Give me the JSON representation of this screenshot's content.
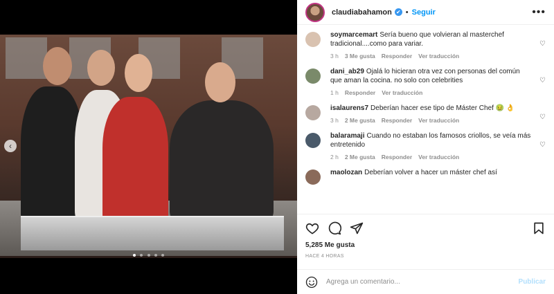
{
  "header": {
    "username": "claudiabahamon",
    "verified_glyph": "✔",
    "separator": "•",
    "follow_label": "Seguir",
    "more_icon": "more-icon",
    "more_glyph": "•••"
  },
  "media": {
    "prev_glyph": "‹"
  },
  "comments": [
    {
      "user": "soymarcemart",
      "text": "Sería bueno que volvieran al masterchef tradicional....como para variar.",
      "time": "3 h",
      "likes": "3 Me gusta",
      "reply": "Responder",
      "translate": "Ver traducción",
      "avatar_color": "#d9c2b0"
    },
    {
      "user": "dani_ab29",
      "text": "Ojalá lo hicieran otra vez con personas del común que aman la cocina. no solo con celebrities",
      "time": "1 h",
      "likes": "",
      "reply": "Responder",
      "translate": "Ver traducción",
      "avatar_color": "#7a8a6a"
    },
    {
      "user": "isalaurens7",
      "text": "Deberían hacer ese tipo de Máster Chef 🤢 👌",
      "time": "3 h",
      "likes": "2 Me gusta",
      "reply": "Responder",
      "translate": "Ver traducción",
      "avatar_color": "#b7a8a0"
    },
    {
      "user": "balaramaji",
      "text": "Cuando no estaban los famosos criollos, se veía más entretenido",
      "time": "2 h",
      "likes": "2 Me gusta",
      "reply": "Responder",
      "translate": "Ver traducción",
      "avatar_color": "#4a5a6a"
    },
    {
      "user": "maolozan",
      "text": "Deberían volver a hacer un máster chef así",
      "time": "",
      "likes": "",
      "reply": "",
      "translate": "",
      "avatar_color": "#8a6a5a"
    }
  ],
  "likes": {
    "heart_glyph": "♡"
  },
  "footer": {
    "likes_count": "5,285 Me gusta",
    "time_ago": "HACE 4 HORAS",
    "comment_placeholder": "Agrega un comentario...",
    "post_label": "Publicar"
  },
  "colors": {
    "accent": "#0095f6",
    "verified": "#3897f0",
    "post_disabled": "#b2dffc"
  }
}
